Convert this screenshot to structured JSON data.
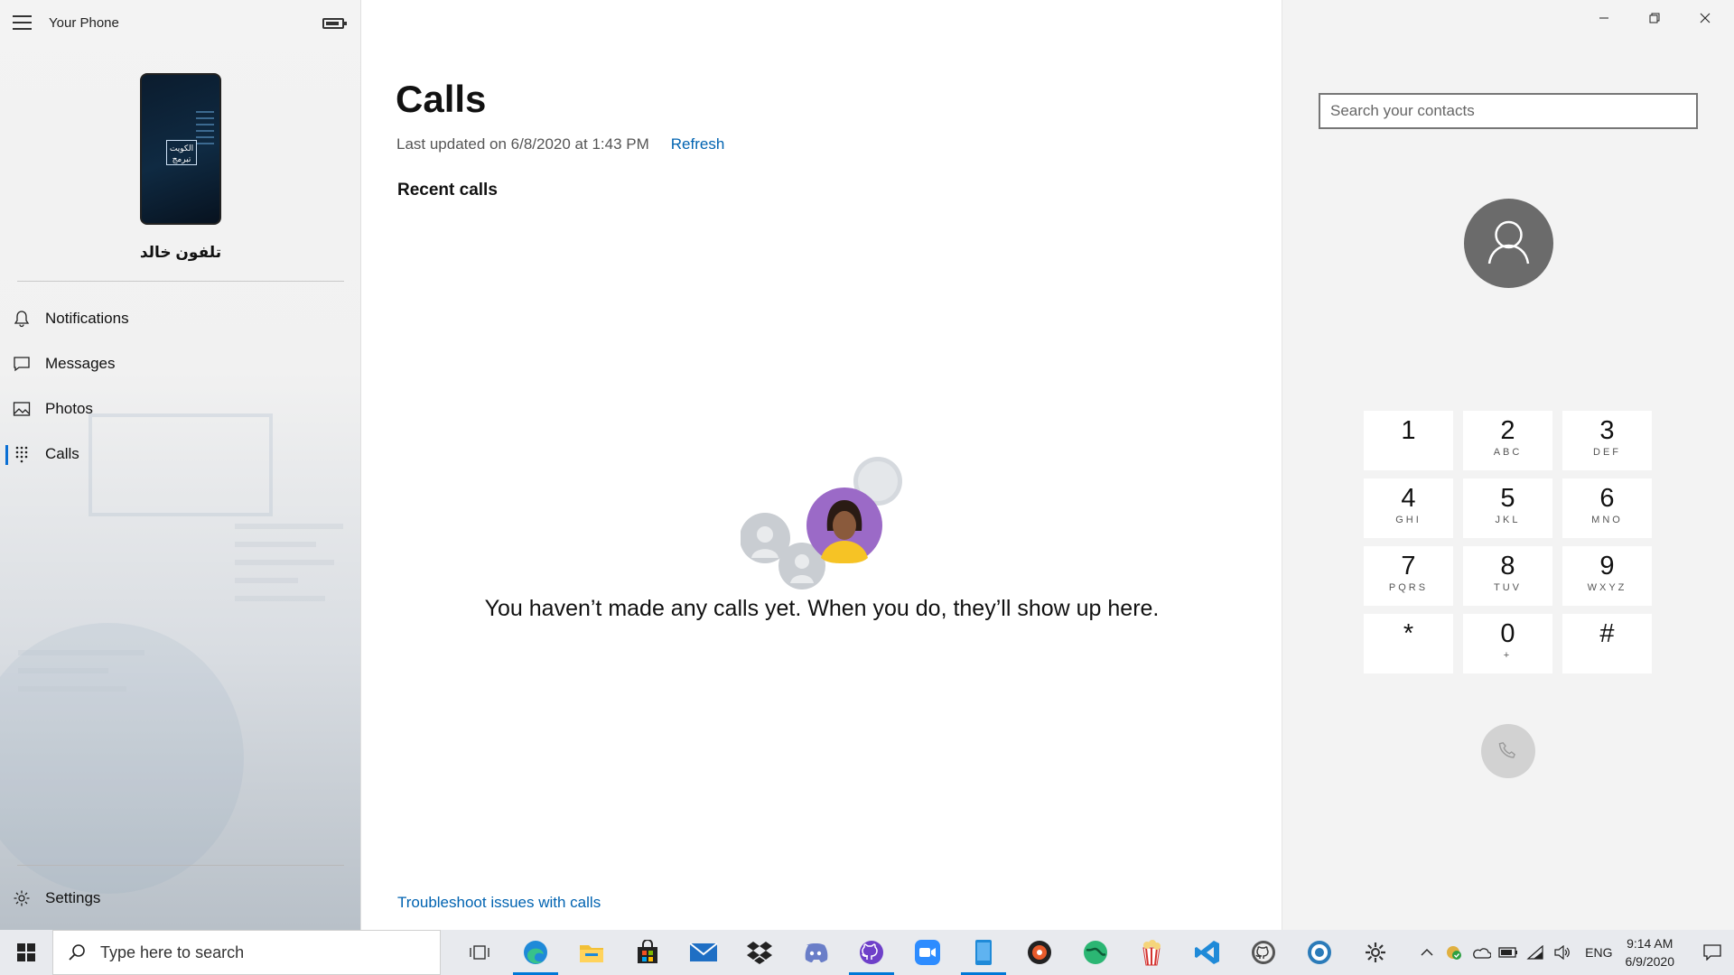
{
  "app": {
    "title": "Your Phone"
  },
  "device": {
    "name": "تلفون خالد",
    "logo_text": "الكويت تبرمج"
  },
  "nav": {
    "items": [
      {
        "label": "Notifications",
        "icon": "bell-icon"
      },
      {
        "label": "Messages",
        "icon": "chat-icon"
      },
      {
        "label": "Photos",
        "icon": "image-icon"
      },
      {
        "label": "Calls",
        "icon": "dialpad-icon",
        "active": true
      }
    ],
    "settings_label": "Settings"
  },
  "main": {
    "title": "Calls",
    "updated": "Last updated on 6/8/2020 at 1:43 PM",
    "refresh_label": "Refresh",
    "section_title": "Recent calls",
    "empty_message": "You haven’t made any calls yet. When you do, they’ll show up here.",
    "troubleshoot_label": "Troubleshoot issues with calls"
  },
  "dialer": {
    "search_placeholder": "Search your contacts",
    "keys": [
      {
        "digit": "1",
        "letters": ""
      },
      {
        "digit": "2",
        "letters": "ABC"
      },
      {
        "digit": "3",
        "letters": "DEF"
      },
      {
        "digit": "4",
        "letters": "GHI"
      },
      {
        "digit": "5",
        "letters": "JKL"
      },
      {
        "digit": "6",
        "letters": "MNO"
      },
      {
        "digit": "7",
        "letters": "PQRS"
      },
      {
        "digit": "8",
        "letters": "TUV"
      },
      {
        "digit": "9",
        "letters": "WXYZ"
      },
      {
        "digit": "*",
        "letters": ""
      },
      {
        "digit": "0",
        "letters": "+"
      },
      {
        "digit": "#",
        "letters": ""
      }
    ]
  },
  "taskbar": {
    "search_placeholder": "Type here to search",
    "pinned": [
      "task-view-icon",
      "edge-icon",
      "file-explorer-icon",
      "store-icon",
      "mail-icon",
      "dropbox-icon",
      "discord-icon",
      "github-icon",
      "zoom-icon",
      "your-phone-icon",
      "music-icon",
      "globe-icon",
      "popcorn-icon",
      "vscode-icon",
      "github-desktop-icon",
      "github-alt-icon",
      "settings-gear-icon"
    ],
    "language": "ENG",
    "time": "9:14 AM",
    "date": "6/9/2020"
  },
  "colors": {
    "accent": "#0063b1",
    "active_indicator": "#0a6fd4",
    "avatar": "#6b6b6b"
  }
}
